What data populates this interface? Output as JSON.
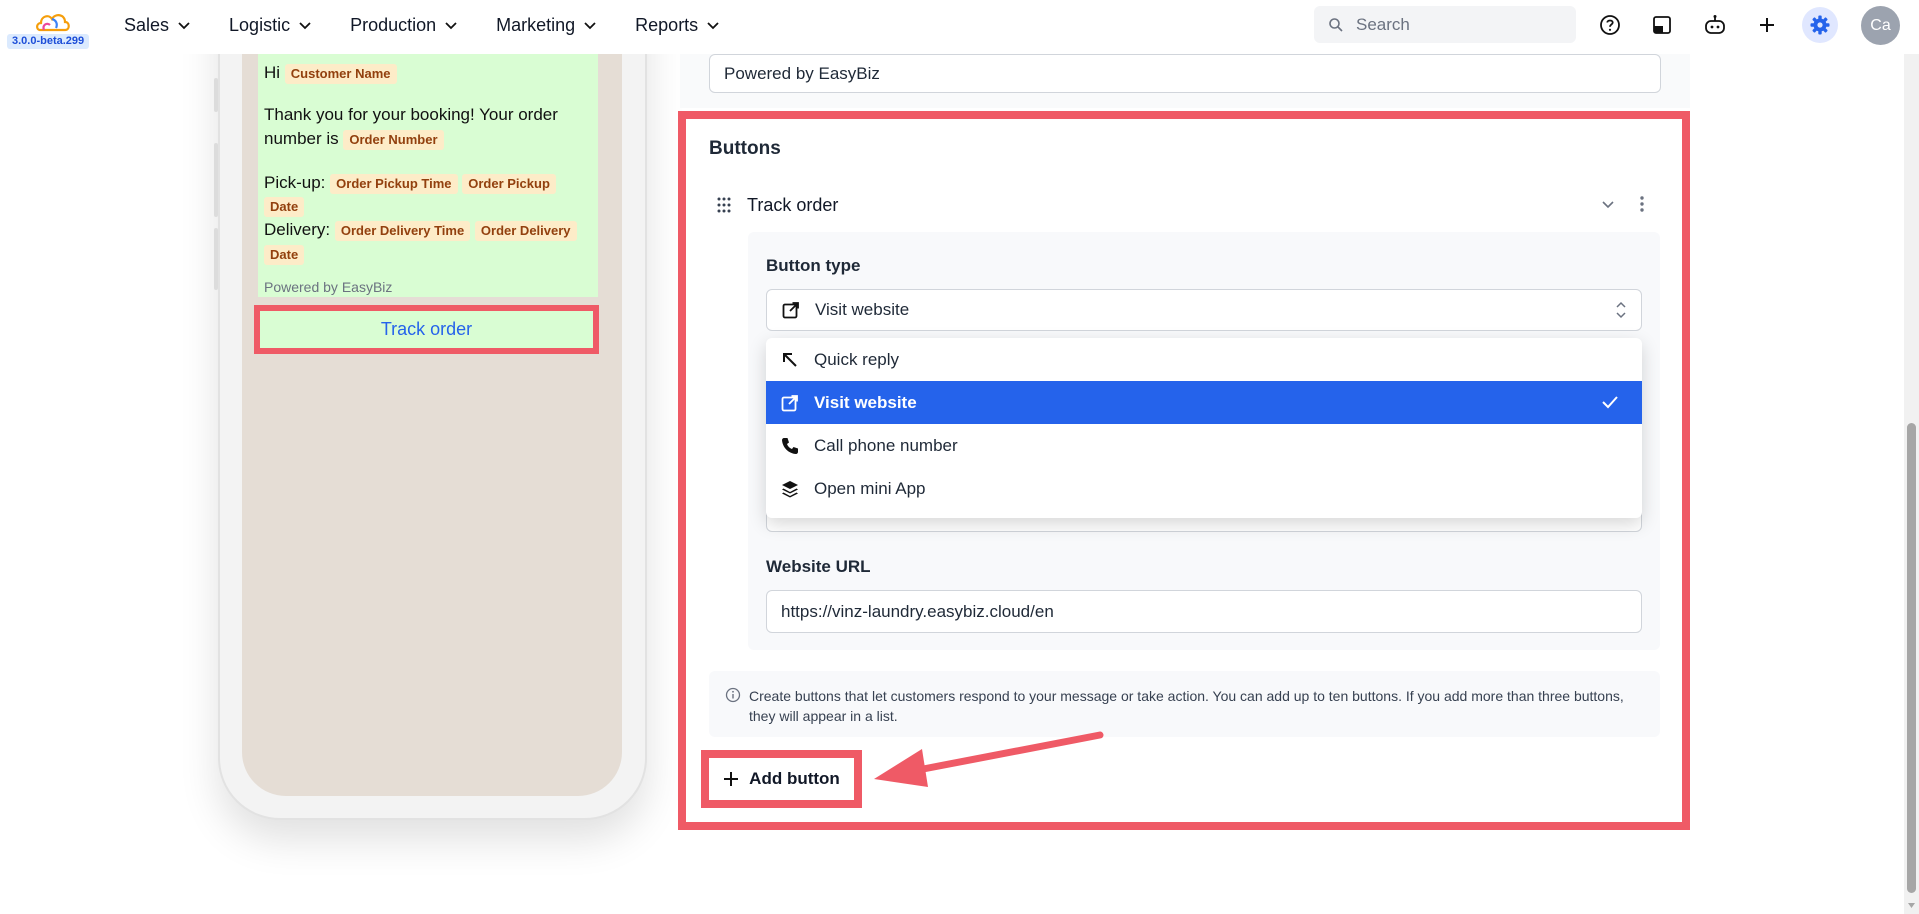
{
  "app": {
    "version": "3.0.0-beta.299"
  },
  "nav": {
    "items": [
      {
        "label": "Sales"
      },
      {
        "label": "Logistic"
      },
      {
        "label": "Production"
      },
      {
        "label": "Marketing"
      },
      {
        "label": "Reports"
      }
    ],
    "search_placeholder": "Search",
    "avatar_initials": "Ca"
  },
  "preview": {
    "greeting": "Hi",
    "customer_name_tag": "Customer Name",
    "thank_you_line1": "Thank you for your booking! Your order",
    "thank_you_line2": "number is",
    "order_number_tag": "Order Number",
    "pickup_label": "Pick-up:",
    "pickup_time_tag": "Order Pickup Time",
    "pickup_date_tag_a": "Order Pickup",
    "pickup_date_tag_b": "Date",
    "delivery_label": "Delivery:",
    "delivery_time_tag": "Order Delivery Time",
    "delivery_date_tag_a": "Order Delivery",
    "delivery_date_tag_b": "Date",
    "footer": "Powered by EasyBiz",
    "track_button": "Track order"
  },
  "editor": {
    "footer_value": "Powered by EasyBiz",
    "buttons_section_title": "Buttons",
    "button_item_name": "Track order",
    "button_type_label": "Button type",
    "button_type_selected": "Visit website",
    "button_type_options": [
      {
        "label": "Quick reply",
        "icon": "arrow-up-left-icon",
        "selected": false
      },
      {
        "label": "Visit website",
        "icon": "external-link-icon",
        "selected": true
      },
      {
        "label": "Call phone number",
        "icon": "phone-icon",
        "selected": false
      },
      {
        "label": "Open mini App",
        "icon": "layers-icon",
        "selected": false
      }
    ],
    "website_url_label": "Website URL",
    "website_url_value": "https://vinz-laundry.easybiz.cloud/en",
    "info_text": "Create buttons that let customers respond to your message or take action. You can add up to ten buttons. If you add more than three buttons, they will appear in a list.",
    "add_button_label": "Add button"
  },
  "colors": {
    "annotation": "#ef5a66",
    "accent": "#2563eb",
    "bubble": "#d9fdd3"
  }
}
